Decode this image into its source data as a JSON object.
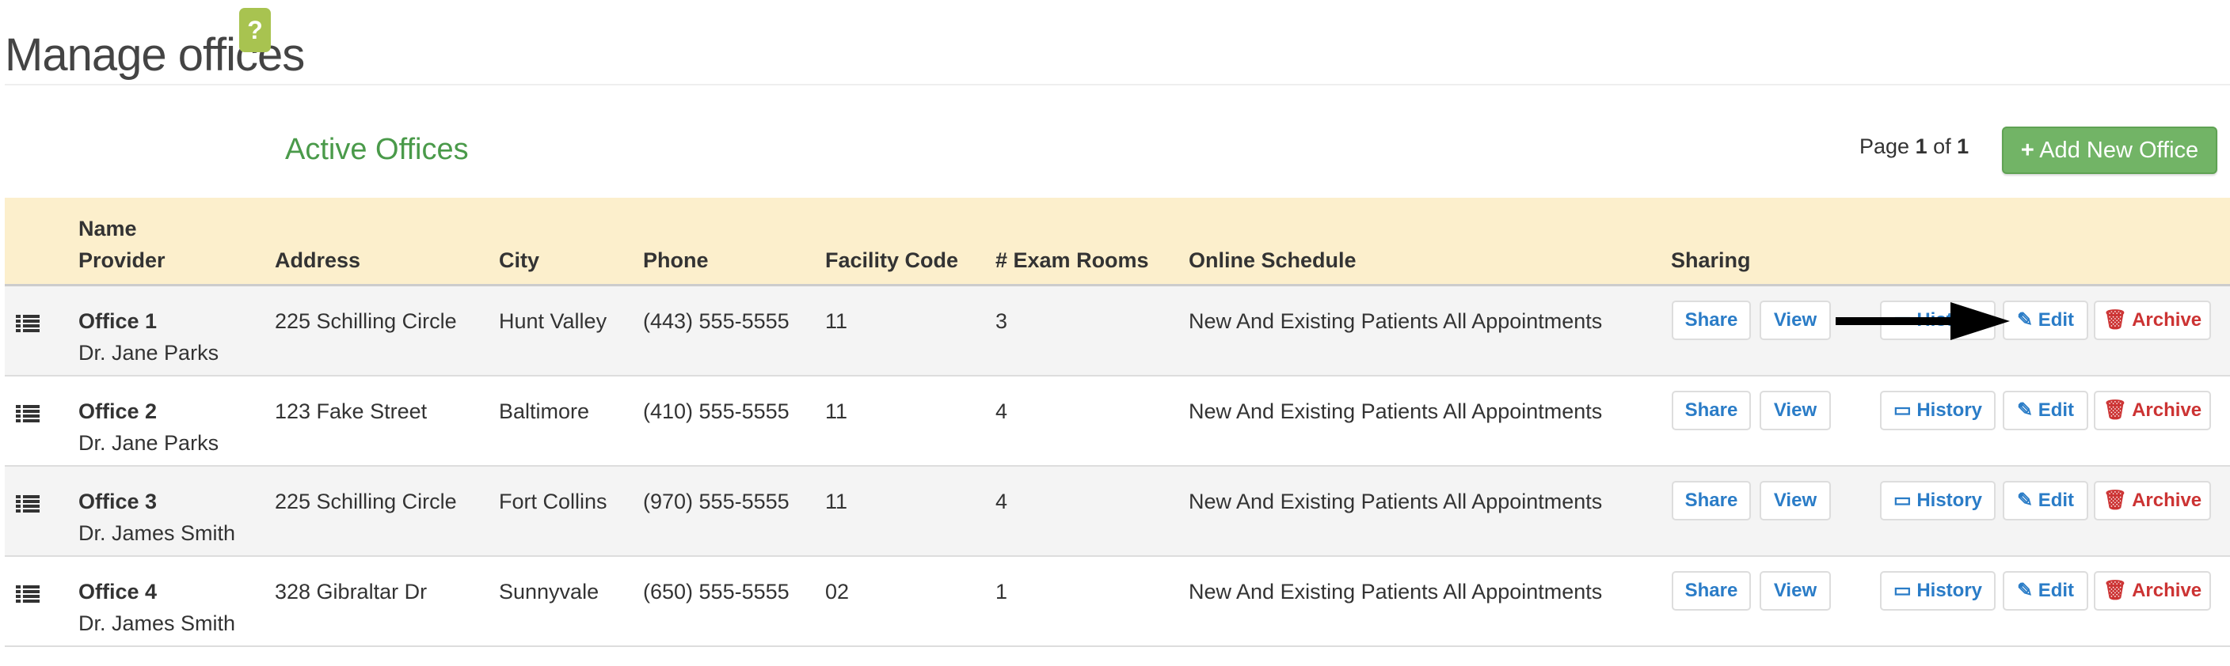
{
  "page": {
    "title": "Manage offices",
    "help_label": "?",
    "section_title": "Active Offices",
    "pagination": {
      "prefix": "Page",
      "current": "1",
      "of": "of",
      "total": "1"
    },
    "add_button": "Add New Office",
    "add_icon": "plus-icon"
  },
  "table": {
    "headers": {
      "name": "Name",
      "provider": "Provider",
      "address": "Address",
      "city": "City",
      "phone": "Phone",
      "facility_code": "Facility Code",
      "exam_rooms": "# Exam Rooms",
      "online_schedule": "Online Schedule",
      "sharing": "Sharing"
    },
    "buttons": {
      "share": "Share",
      "view": "View",
      "history": "History",
      "edit": "Edit",
      "archive": "Archive"
    },
    "rows": [
      {
        "name": "Office 1",
        "provider": "Dr. Jane Parks",
        "address": "225 Schilling Circle",
        "city": "Hunt Valley",
        "phone": "(443) 555-5555",
        "facility_code": "11",
        "exam_rooms": "3",
        "online_schedule": "New And Existing Patients All Appointments"
      },
      {
        "name": "Office 2",
        "provider": "Dr. Jane Parks",
        "address": "123 Fake Street",
        "city": "Baltimore",
        "phone": "(410) 555-5555",
        "facility_code": "11",
        "exam_rooms": "4",
        "online_schedule": "New And Existing Patients All Appointments"
      },
      {
        "name": "Office 3",
        "provider": "Dr. James Smith",
        "address": "225 Schilling Circle",
        "city": "Fort Collins",
        "phone": "(970) 555-5555",
        "facility_code": "11",
        "exam_rooms": "4",
        "online_schedule": "New And Existing Patients All Appointments"
      },
      {
        "name": "Office 4",
        "provider": "Dr. James Smith",
        "address": "328 Gibraltar Dr",
        "city": "Sunnyvale",
        "phone": "(650) 555-5555",
        "facility_code": "02",
        "exam_rooms": "1",
        "online_schedule": "New And Existing Patients All Appointments"
      }
    ]
  },
  "colors": {
    "accent_green": "#72b466",
    "header_bg": "#fcefcc",
    "link_blue": "#2a7cc7",
    "danger_red": "#cc3333",
    "help_green": "#a8c350"
  }
}
